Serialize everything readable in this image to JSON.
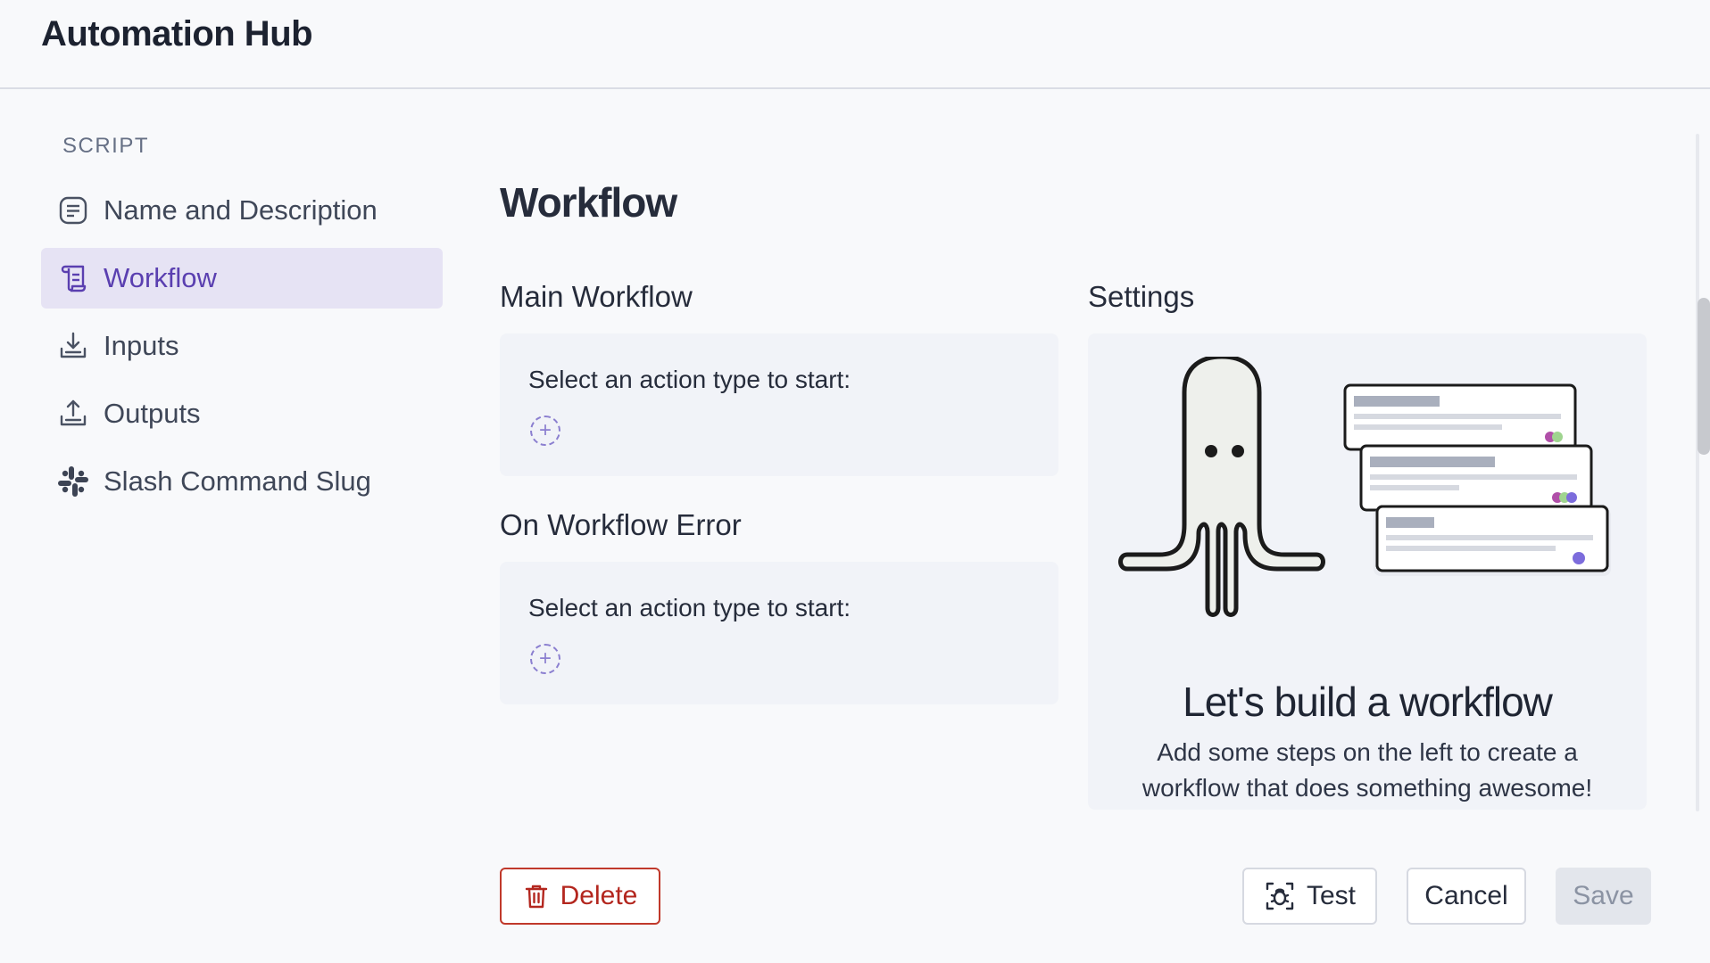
{
  "app": {
    "title": "Automation Hub"
  },
  "sidebar": {
    "section_label": "SCRIPT",
    "items": [
      {
        "label": "Name and Description",
        "icon": "document-lines-icon",
        "active": false
      },
      {
        "label": "Workflow",
        "icon": "scroll-icon",
        "active": true
      },
      {
        "label": "Inputs",
        "icon": "download-tray-icon",
        "active": false
      },
      {
        "label": "Outputs",
        "icon": "upload-tray-icon",
        "active": false
      },
      {
        "label": "Slash Command Slug",
        "icon": "slack-icon",
        "active": false
      }
    ]
  },
  "main": {
    "page_title": "Workflow",
    "main_workflow": {
      "title": "Main Workflow",
      "prompt": "Select an action type to start:",
      "add_icon": "add-dashed-circle-icon"
    },
    "on_error": {
      "title": "On Workflow Error",
      "prompt": "Select an action type to start:",
      "add_icon": "add-dashed-circle-icon"
    },
    "settings": {
      "title": "Settings",
      "empty_title": "Let's build a workflow",
      "empty_description": "Add some steps on the left to create a workflow that does something awesome!",
      "illustration": "octopus-cards-illustration"
    }
  },
  "footer": {
    "delete_label": "Delete",
    "test_label": "Test",
    "cancel_label": "Cancel",
    "save_label": "Save",
    "save_disabled": true
  },
  "colors": {
    "accent": "#5a3fb0",
    "accent_bg": "#e6e3f4",
    "danger": "#b3261e",
    "panel_bg": "#f1f3f8",
    "page_bg": "#f8f9fb"
  }
}
